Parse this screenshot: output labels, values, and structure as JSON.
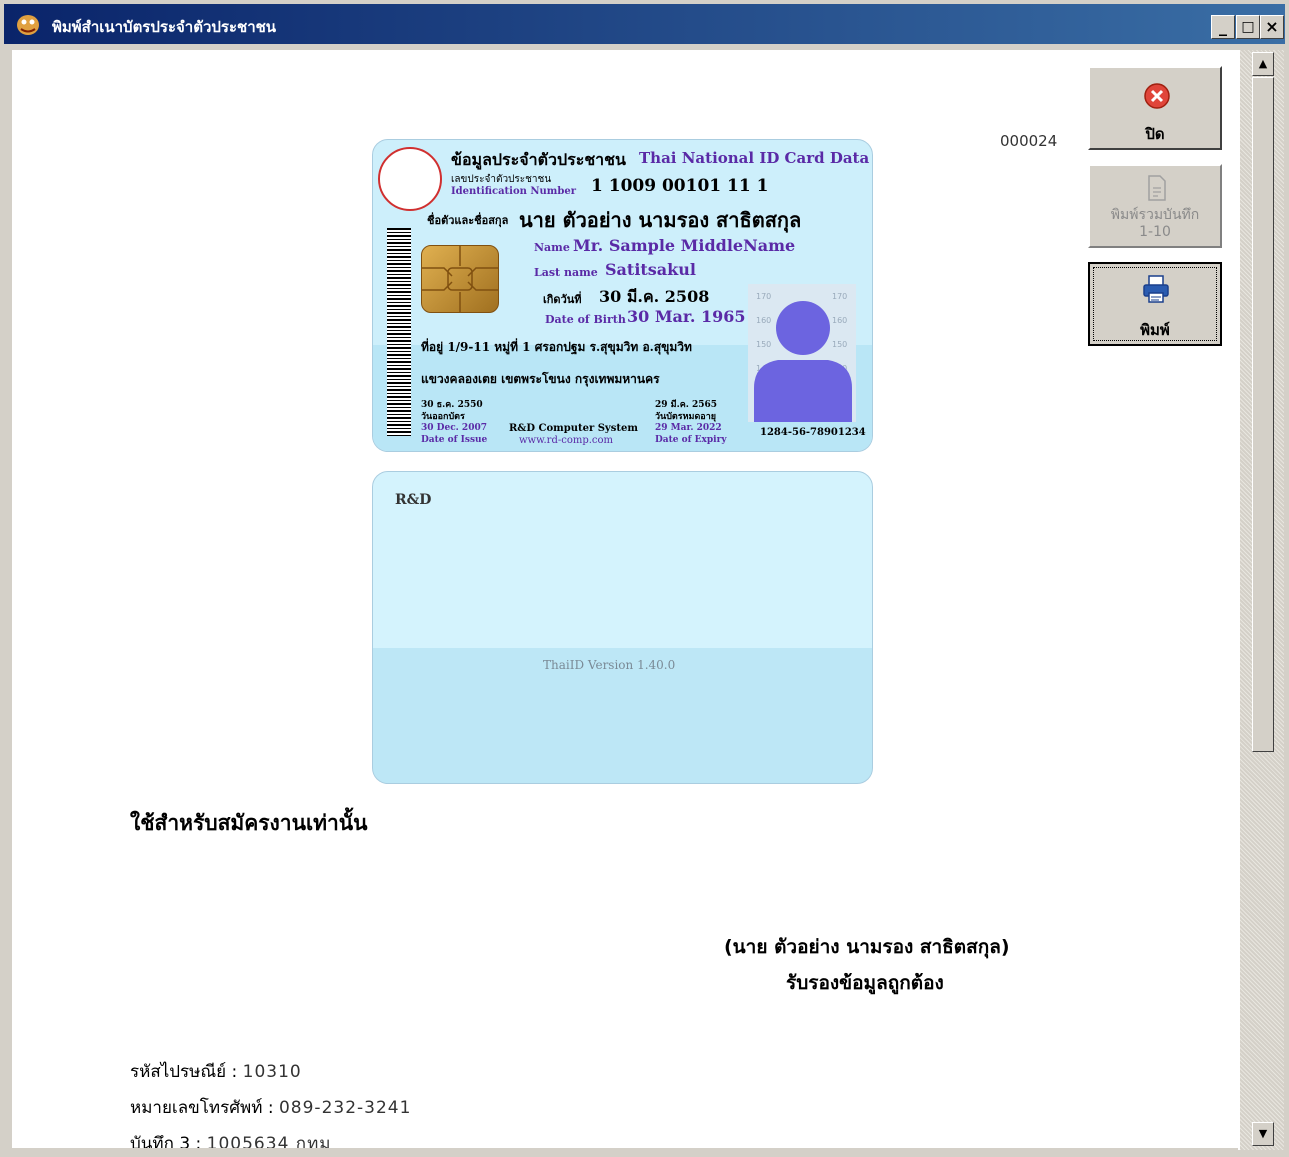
{
  "window": {
    "title": "พิมพ์สำเนาบัตรประจำตัวประชาชน"
  },
  "window_controls": {
    "minimize": "_",
    "maximize": "□",
    "close": "×"
  },
  "toolbar": {
    "close_label": "ปิด",
    "print_combined_label_line1": "พิมพ์รวมบันทึก",
    "print_combined_label_line2": "1-10",
    "print_label": "พิมพ์"
  },
  "document": {
    "number": "000024"
  },
  "card_front": {
    "header_th": "ข้อมูลประจำตัวประชาชน",
    "header_en": "Thai National ID Card Data",
    "id_label_th": "เลขประจำตัวประชาชน",
    "id_label_en": "Identification Number",
    "id_number": "1 1009 00101 11 1",
    "name_label_th": "ชื่อตัวและชื่อสกุล",
    "name_th": "นาย ตัวอย่าง นามรอง สาธิตสกุล",
    "name_label_en": "Name",
    "name_en": "Mr. Sample MiddleName",
    "lastname_label_en": "Last name",
    "lastname_en": "Satitsakul",
    "dob_label_th": "เกิดวันที่",
    "dob_th": "30 มี.ค. 2508",
    "dob_label_en": "Date of Birth",
    "dob_en": "30 Mar. 1965",
    "address": "ที่อยู่ 1/9-11 หมู่ที่ 1 ศรอกปฐม ร.สุขุมวิท อ.สุขุมวิท",
    "address_line2": "แขวงคลองเตย เขตพระโขนง กรุงเทพมหานคร",
    "issue_date_th": "30 ธ.ค. 2550",
    "issue_label_th": "วันออกบัตร",
    "issue_date_en": "30 Dec. 2007",
    "issue_label_en": "Date of Issue",
    "issuer": "R&D Computer System",
    "issuer_url": "www.rd-comp.com",
    "expiry_date_th": "29 มี.ค. 2565",
    "expiry_label_th": "วันบัตรหมดอายุ",
    "expiry_date_en": "29 Mar. 2022",
    "expiry_label_en": "Date of Expiry",
    "card_code": "1284-56-78901234",
    "height_marks": [
      "170",
      "170",
      "160",
      "160",
      "150",
      "150",
      "140",
      "140"
    ]
  },
  "card_back": {
    "brand": "R&D",
    "version": "ThaiID Version 1.40.0"
  },
  "page": {
    "usage_note": "ใช้สำหรับสมัครงานเท่านั้น",
    "signer_name": "(นาย ตัวอย่าง นามรอง สาธิตสกุล)",
    "certify_text": "รับรองข้อมูลถูกต้อง",
    "postal_label": "รหัสไปรษณีย์ : ",
    "postal_code": "10310",
    "phone_label": "หมายเลขโทรศัพท์ : ",
    "phone": "089-232-3241",
    "note3_label": "บันทึก 3 : ",
    "note3": "1005634 กทม"
  },
  "colors": {
    "card_bg": "#cdeffb",
    "card_text_purple": "#5a2aa6",
    "titlebar": "#0a246a",
    "close_icon": "#e0453a"
  }
}
